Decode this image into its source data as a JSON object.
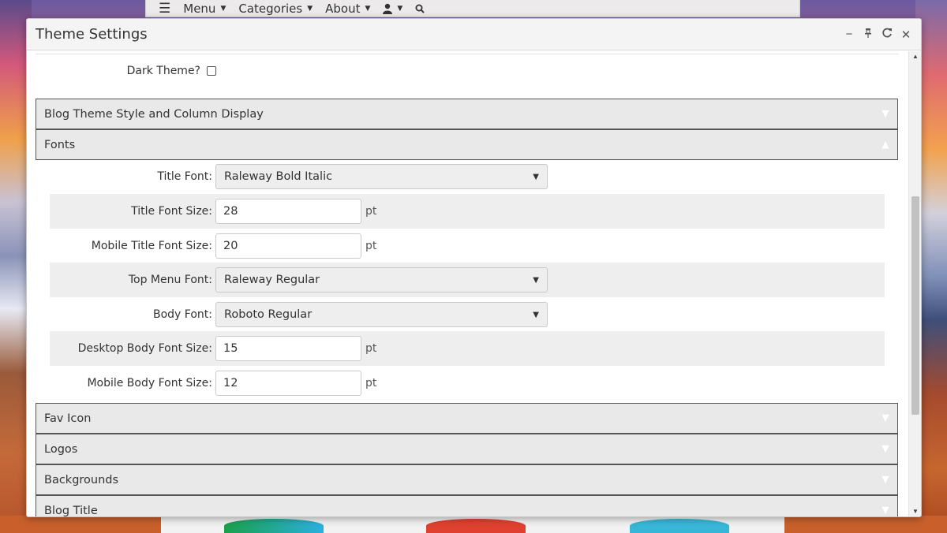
{
  "site_nav": {
    "menu": "Menu",
    "categories": "Categories",
    "about": "About"
  },
  "dialog": {
    "title": "Theme Settings",
    "dark_theme_label": "Dark Theme?",
    "dark_theme_checked": false,
    "sections": [
      {
        "label": "Blog Theme Style and Column Display",
        "expanded": false
      },
      {
        "label": "Fonts",
        "expanded": true
      },
      {
        "label": "Fav Icon",
        "expanded": false
      },
      {
        "label": "Logos",
        "expanded": false
      },
      {
        "label": "Backgrounds",
        "expanded": false
      },
      {
        "label": "Blog Title",
        "expanded": false
      }
    ],
    "fonts": {
      "title_font": {
        "label": "Title Font:",
        "value": "Raleway Bold Italic"
      },
      "title_font_size": {
        "label": "Title Font Size:",
        "value": "28",
        "unit": "pt"
      },
      "mobile_title_font_size": {
        "label": "Mobile Title Font Size:",
        "value": "20",
        "unit": "pt"
      },
      "top_menu_font": {
        "label": "Top Menu Font:",
        "value": "Raleway Regular"
      },
      "body_font": {
        "label": "Body Font:",
        "value": "Roboto Regular"
      },
      "desktop_body_font_size": {
        "label": "Desktop Body Font Size:",
        "value": "15",
        "unit": "pt"
      },
      "mobile_body_font_size": {
        "label": "Mobile Body Font Size:",
        "value": "12",
        "unit": "pt"
      }
    }
  },
  "colors": {
    "dialog_bg": "#ffffff",
    "accordion_header_bg": "#e9e9e9",
    "alt_row_bg": "#eeeeee"
  }
}
